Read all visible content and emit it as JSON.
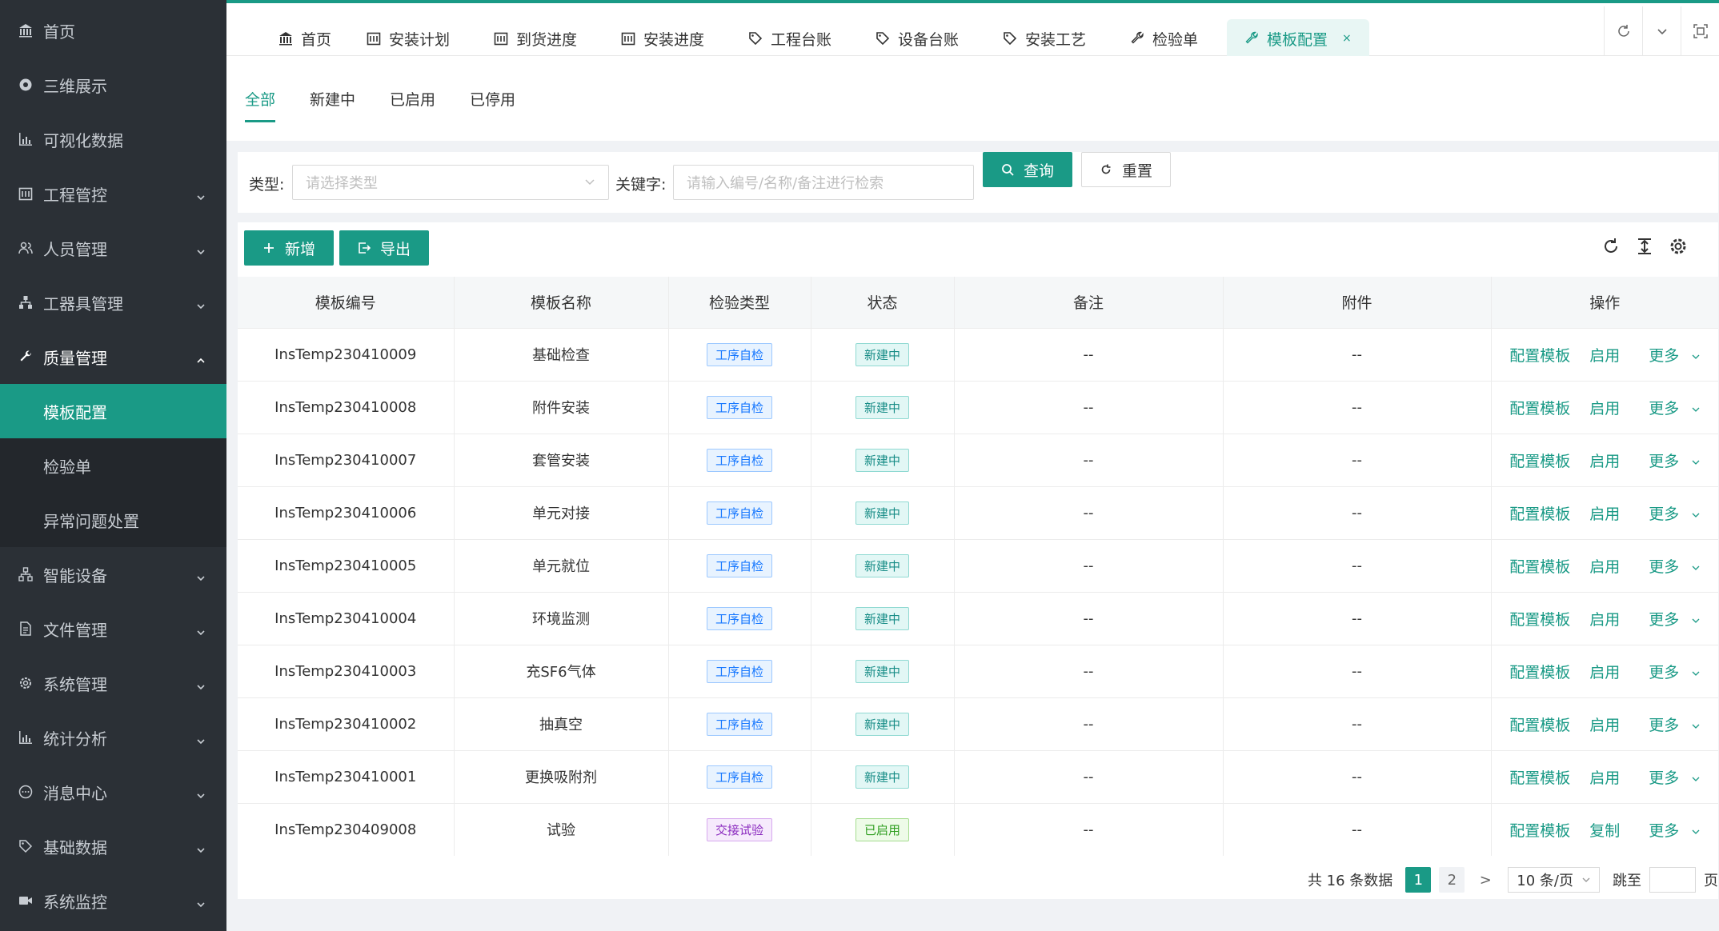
{
  "sidebar": {
    "items": [
      {
        "label": "首页",
        "icon": "bank-icon"
      },
      {
        "label": "三维展示",
        "icon": "globe-icon"
      },
      {
        "label": "可视化数据",
        "icon": "bar-chart-icon"
      },
      {
        "label": "工程管控",
        "icon": "calendar-icon"
      },
      {
        "label": "人员管理",
        "icon": "users-icon"
      },
      {
        "label": "工器具管理",
        "icon": "cluster-icon"
      },
      {
        "label": "质量管理",
        "icon": "wrench-icon"
      },
      {
        "label": "智能设备",
        "icon": "cluster-icon"
      },
      {
        "label": "文件管理",
        "icon": "file-icon"
      },
      {
        "label": "系统管理",
        "icon": "gear-icon"
      },
      {
        "label": "统计分析",
        "icon": "bar-chart-icon"
      },
      {
        "label": "消息中心",
        "icon": "message-icon"
      },
      {
        "label": "基础数据",
        "icon": "tag-icon"
      },
      {
        "label": "系统监控",
        "icon": "video-icon"
      }
    ],
    "quality_sub": [
      "模板配置",
      "检验单",
      "异常问题处置"
    ]
  },
  "tabs": [
    {
      "label": "首页",
      "icon": "bank-icon"
    },
    {
      "label": "安装计划",
      "icon": "calendar-icon"
    },
    {
      "label": "到货进度",
      "icon": "calendar-icon"
    },
    {
      "label": "安装进度",
      "icon": "calendar-icon"
    },
    {
      "label": "工程台账",
      "icon": "tag-icon"
    },
    {
      "label": "设备台账",
      "icon": "tag-icon"
    },
    {
      "label": "安装工艺",
      "icon": "tag-icon"
    },
    {
      "label": "检验单",
      "icon": "wrench-icon"
    },
    {
      "label": "模板配置",
      "icon": "wrench-icon"
    }
  ],
  "status_tabs": [
    "全部",
    "新建中",
    "已启用",
    "已停用"
  ],
  "filter": {
    "type_label": "类型:",
    "type_placeholder": "请选择类型",
    "keyword_label": "关键字:",
    "keyword_placeholder": "请输入编号/名称/备注进行检索",
    "query": "查询",
    "reset": "重置"
  },
  "actions": {
    "add": "新增",
    "export": "导出"
  },
  "table": {
    "columns": [
      "模板编号",
      "模板名称",
      "检验类型",
      "状态",
      "备注",
      "附件",
      "操作"
    ],
    "rows": [
      {
        "code": "InsTemp230410009",
        "name": "基础检查",
        "type": "工序自检",
        "status": "新建中",
        "remark": "--",
        "attachment": "--",
        "op2": "启用"
      },
      {
        "code": "InsTemp230410008",
        "name": "附件安装",
        "type": "工序自检",
        "status": "新建中",
        "remark": "--",
        "attachment": "--",
        "op2": "启用"
      },
      {
        "code": "InsTemp230410007",
        "name": "套管安装",
        "type": "工序自检",
        "status": "新建中",
        "remark": "--",
        "attachment": "--",
        "op2": "启用"
      },
      {
        "code": "InsTemp230410006",
        "name": "单元对接",
        "type": "工序自检",
        "status": "新建中",
        "remark": "--",
        "attachment": "--",
        "op2": "启用"
      },
      {
        "code": "InsTemp230410005",
        "name": "单元就位",
        "type": "工序自检",
        "status": "新建中",
        "remark": "--",
        "attachment": "--",
        "op2": "启用"
      },
      {
        "code": "InsTemp230410004",
        "name": "环境监测",
        "type": "工序自检",
        "status": "新建中",
        "remark": "--",
        "attachment": "--",
        "op2": "启用"
      },
      {
        "code": "InsTemp230410003",
        "name": "充SF6气体",
        "type": "工序自检",
        "status": "新建中",
        "remark": "--",
        "attachment": "--",
        "op2": "启用"
      },
      {
        "code": "InsTemp230410002",
        "name": "抽真空",
        "type": "工序自检",
        "status": "新建中",
        "remark": "--",
        "attachment": "--",
        "op2": "启用"
      },
      {
        "code": "InsTemp230410001",
        "name": "更换吸附剂",
        "type": "工序自检",
        "status": "新建中",
        "remark": "--",
        "attachment": "--",
        "op2": "启用"
      },
      {
        "code": "InsTemp230409008",
        "name": "试验",
        "type": "交接试验",
        "status": "已启用",
        "remark": "--",
        "attachment": "--",
        "op2": "复制"
      }
    ],
    "op1": "配置模板",
    "op_more": "更多"
  },
  "pagination": {
    "total": "共 16 条数据",
    "pages": [
      "1",
      "2"
    ],
    "next": ">",
    "page_size": "10 条/页",
    "jump_label": "跳至",
    "jump_unit": "页"
  },
  "colors": {
    "accent": "#1a9a86",
    "sidebar_bg": "#2b3036"
  }
}
